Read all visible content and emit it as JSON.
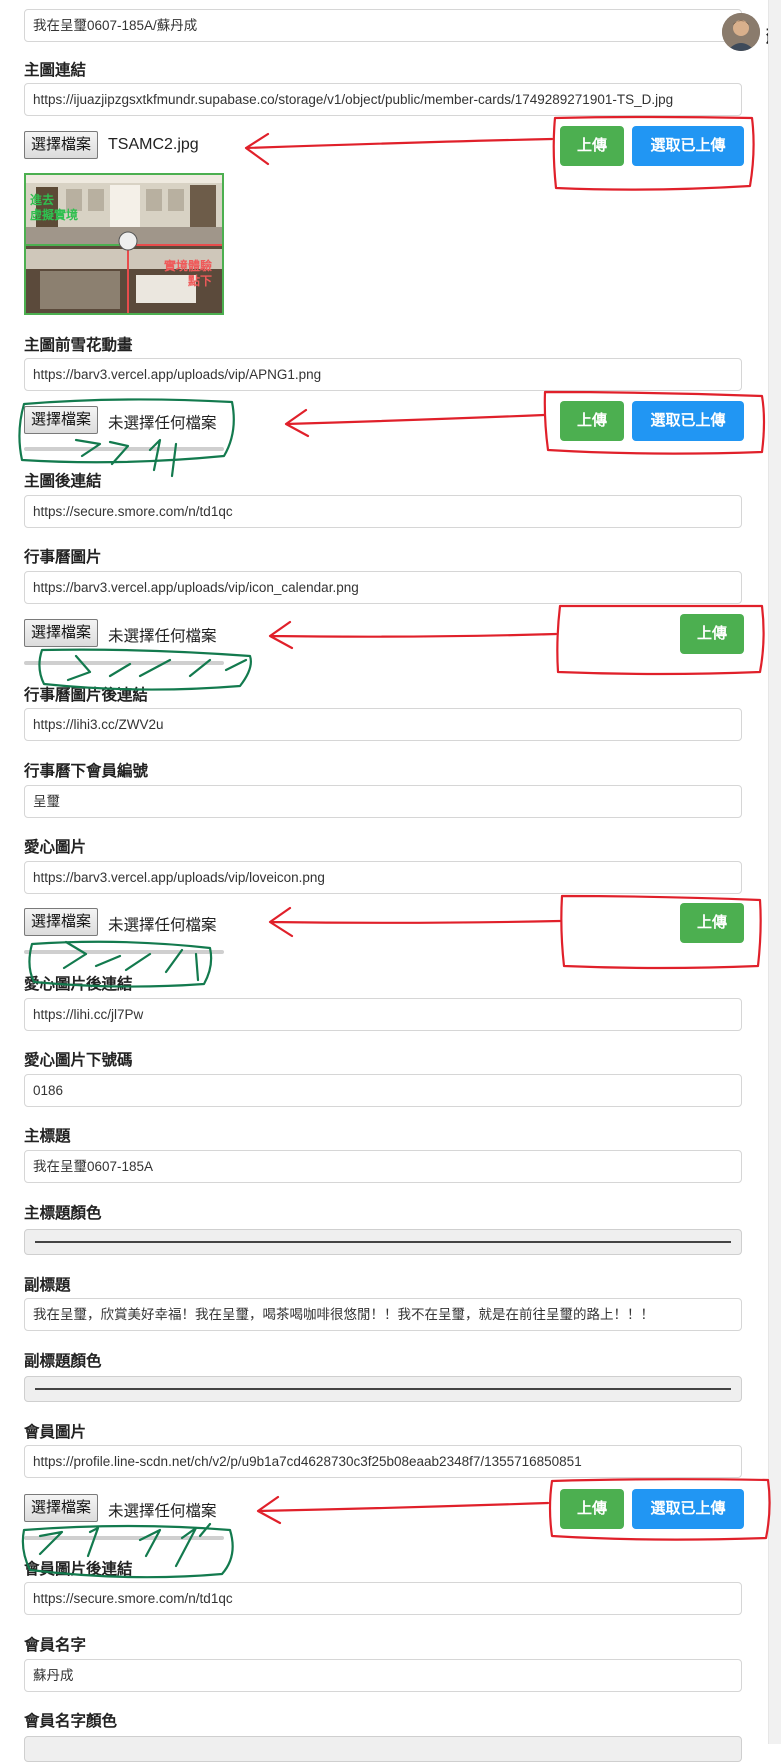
{
  "header_input": "我在呈璽0607-185A/蘇丹成",
  "user": {
    "name_partial": "蘇"
  },
  "sections": {
    "main_link": {
      "label": "主圖連結",
      "value": "https://ijuazjipzgsxtkfmundr.supabase.co/storage/v1/object/public/member-cards/1749289271901-TS_D.jpg"
    },
    "file1": {
      "choose": "選擇檔案",
      "filename": "TSAMC2.jpg",
      "upload": "上傳",
      "select_uploaded": "選取已上傳"
    },
    "preview": {
      "left_text": "進去\n虛擬實境",
      "right_text": "實境體驗\n點下"
    },
    "snow_anim": {
      "label": "主圖前雪花動畫",
      "value": "https://barv3.vercel.app/uploads/vip/APNG1.png"
    },
    "file2": {
      "choose": "選擇檔案",
      "filename": "未選擇任何檔案",
      "upload": "上傳",
      "select_uploaded": "選取已上傳"
    },
    "after_link": {
      "label": "主圖後連結",
      "value": "https://secure.smore.com/n/td1qc"
    },
    "calendar_img": {
      "label": "行事曆圖片",
      "value": "https://barv3.vercel.app/uploads/vip/icon_calendar.png"
    },
    "file3": {
      "choose": "選擇檔案",
      "filename": "未選擇任何檔案",
      "upload": "上傳"
    },
    "calendar_link": {
      "label": "行事曆圖片後連結",
      "value": "https://lihi3.cc/ZWV2u"
    },
    "calendar_member": {
      "label": "行事曆下會員編號",
      "value": "呈璽"
    },
    "love_img": {
      "label": "愛心圖片",
      "value": "https://barv3.vercel.app/uploads/vip/loveicon.png"
    },
    "file4": {
      "choose": "選擇檔案",
      "filename": "未選擇任何檔案",
      "upload": "上傳"
    },
    "love_link": {
      "label": "愛心圖片後連結",
      "value": "https://lihi.cc/jl7Pw"
    },
    "love_number": {
      "label": "愛心圖片下號碼",
      "value": "0186"
    },
    "main_title": {
      "label": "主標題",
      "value": "我在呈璽0607-185A"
    },
    "main_title_color": {
      "label": "主標題顏色",
      "value": "#444444"
    },
    "sub_title": {
      "label": "副標題",
      "value": "我在呈璽，欣賞美好幸福！我在呈璽，喝茶喝咖啡很悠閒！！我不在呈璽，就是在前往呈璽的路上！！！"
    },
    "sub_title_color": {
      "label": "副標題顏色",
      "value": "#444444"
    },
    "member_img": {
      "label": "會員圖片",
      "value": "https://profile.line-scdn.net/ch/v2/p/u9b1a7cd4628730c3f25b08eaab2348f7/1355716850851"
    },
    "file5": {
      "choose": "選擇檔案",
      "filename": "未選擇任何檔案",
      "upload": "上傳",
      "select_uploaded": "選取已上傳"
    },
    "member_link": {
      "label": "會員圖片後連結",
      "value": "https://secure.smore.com/n/td1qc"
    },
    "member_name": {
      "label": "會員名字",
      "value": "蘇丹成"
    },
    "member_name_color": {
      "label": "會員名字顏色"
    }
  },
  "colors": {
    "green": "#4caf50",
    "blue": "#2196f3",
    "annotation_red": "#e0202a",
    "annotation_green": "#137a4e"
  }
}
